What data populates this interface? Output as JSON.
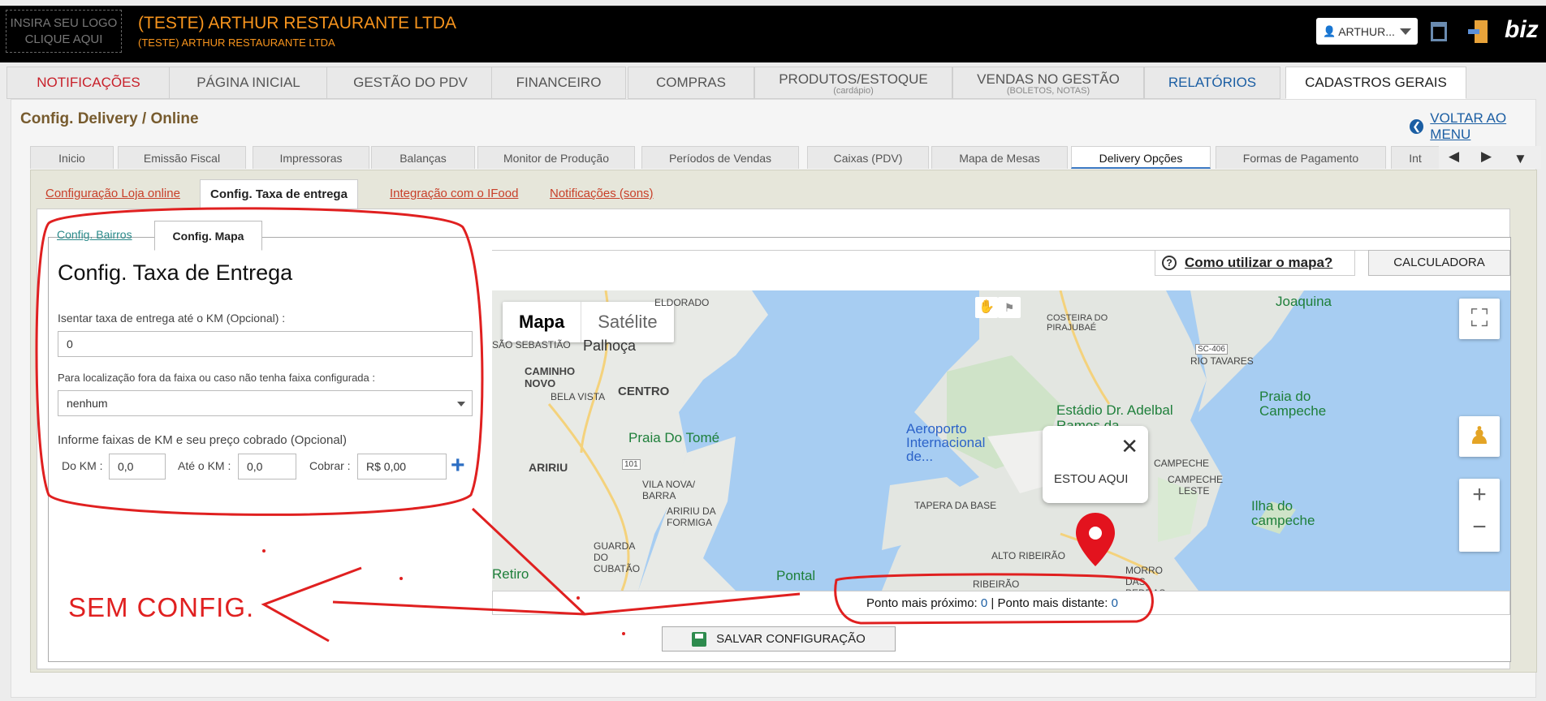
{
  "header": {
    "logo_text_1": "INSIRA SEU LOGO",
    "logo_text_2": "CLIQUE AQUI",
    "company_name": "(TESTE) ARTHUR RESTAURANTE LTDA",
    "company_sub": "(TESTE) ARTHUR RESTAURANTE LTDA",
    "user_label": "ARTHUR...",
    "brand": "biz"
  },
  "main_tabs": [
    {
      "label": "NOTIFICAÇÕES"
    },
    {
      "label": "PÁGINA INICIAL"
    },
    {
      "label": "GESTÃO DO PDV"
    },
    {
      "label": "FINANCEIRO"
    },
    {
      "label": "COMPRAS"
    },
    {
      "label": "PRODUTOS/ESTOQUE",
      "sub": "(cardápio)"
    },
    {
      "label": "VENDAS NO GESTÃO",
      "sub": "(BOLETOS, NOTAS)"
    },
    {
      "label": "RELATÓRIOS"
    },
    {
      "label": "CADASTROS GERAIS"
    }
  ],
  "page": {
    "title": "Config. Delivery / Online",
    "back_link": "VOLTAR AO MENU"
  },
  "sub_tabs": [
    {
      "label": "Inicio"
    },
    {
      "label": "Emissão Fiscal"
    },
    {
      "label": "Impressoras"
    },
    {
      "label": "Balanças"
    },
    {
      "label": "Monitor de Produção"
    },
    {
      "label": "Períodos de Vendas"
    },
    {
      "label": "Caixas (PDV)"
    },
    {
      "label": "Mapa de Mesas"
    },
    {
      "label": "Delivery Opções"
    },
    {
      "label": "Formas de Pagamento"
    },
    {
      "label": "Int"
    }
  ],
  "inner_tabs": [
    {
      "label": "Configuração Loja online"
    },
    {
      "label": "Config. Taxa de entrega"
    },
    {
      "label": "Integração com o IFood"
    },
    {
      "label": "Notificações (sons)"
    }
  ],
  "subsub_tabs": [
    {
      "label": "Config. Bairros"
    },
    {
      "label": "Config. Mapa"
    }
  ],
  "form": {
    "title": "Config. Taxa de Entrega",
    "exempt_label": "Isentar taxa de entrega até o KM (Opcional) :",
    "exempt_value": "0",
    "outside_label": "Para localização fora da faixa ou caso não tenha faixa configurada :",
    "outside_value": "nenhum",
    "ranges_label": "Informe faixas de KM e seu preço cobrado (Opcional)",
    "from_label": "Do KM :",
    "from_value": "0,0",
    "to_label": "Até o KM :",
    "to_value": "0,0",
    "charge_label": "Cobrar :",
    "charge_value": "R$ 0,00"
  },
  "map": {
    "how_to": "Como utilizar o mapa?",
    "calculator": "CALCULADORA",
    "type_map": "Mapa",
    "type_satellite": "Satélite",
    "popup_text": "ESTOU AQUI",
    "labels": {
      "eldorado": "ELDORADO",
      "sao_sebastiao": "SÃO SEBASTIÃO",
      "palhoca": "Palhoça",
      "caminho_novo": "CAMINHO NOVO",
      "bela_vista": "BELA VISTA",
      "centro": "CENTRO",
      "aririu": "ARIRIU",
      "praia_tome": "Praia Do Tomé",
      "aririu_formiga": "ARIRIU DA FORMIGA",
      "vila_nova": "VILA NOVA/ BARRA",
      "guarda_cubatao": "GUARDA DO CUBATÃO",
      "pontal": "Pontal",
      "retiro": "Retiro",
      "aeroporto": "Aeroporto Internacional de...",
      "estadio": "Estádio Dr. Adelbal Ramos da...",
      "costeira": "COSTEIRA DO PIRAJUBAÉ",
      "rio_tavares": "RIO TAVARES",
      "praia_campeche": "Praia do Campeche",
      "joaquina": "Joaquina",
      "campeche": "CAMPECHE",
      "campeche_leste": "CAMPECHE LESTE",
      "ilha_campeche": "Ilha do campeche",
      "tapera": "TAPERA DA BASE",
      "alto_ribeirao": "ALTO RIBEIRÃO",
      "morro_pedras": "MORRO DAS PEDRAS",
      "ribeirao": "RIBEIRÃO",
      "sc406": "SC-406",
      "r101": "101"
    }
  },
  "status": {
    "nearest_label": "Ponto mais próximo:",
    "nearest_value": "0",
    "separator": "|",
    "farthest_label": "Ponto mais distante:",
    "farthest_value": "0"
  },
  "save_button": "SALVAR CONFIGURAÇÃO",
  "annotation_text": "SEM CONFIG."
}
